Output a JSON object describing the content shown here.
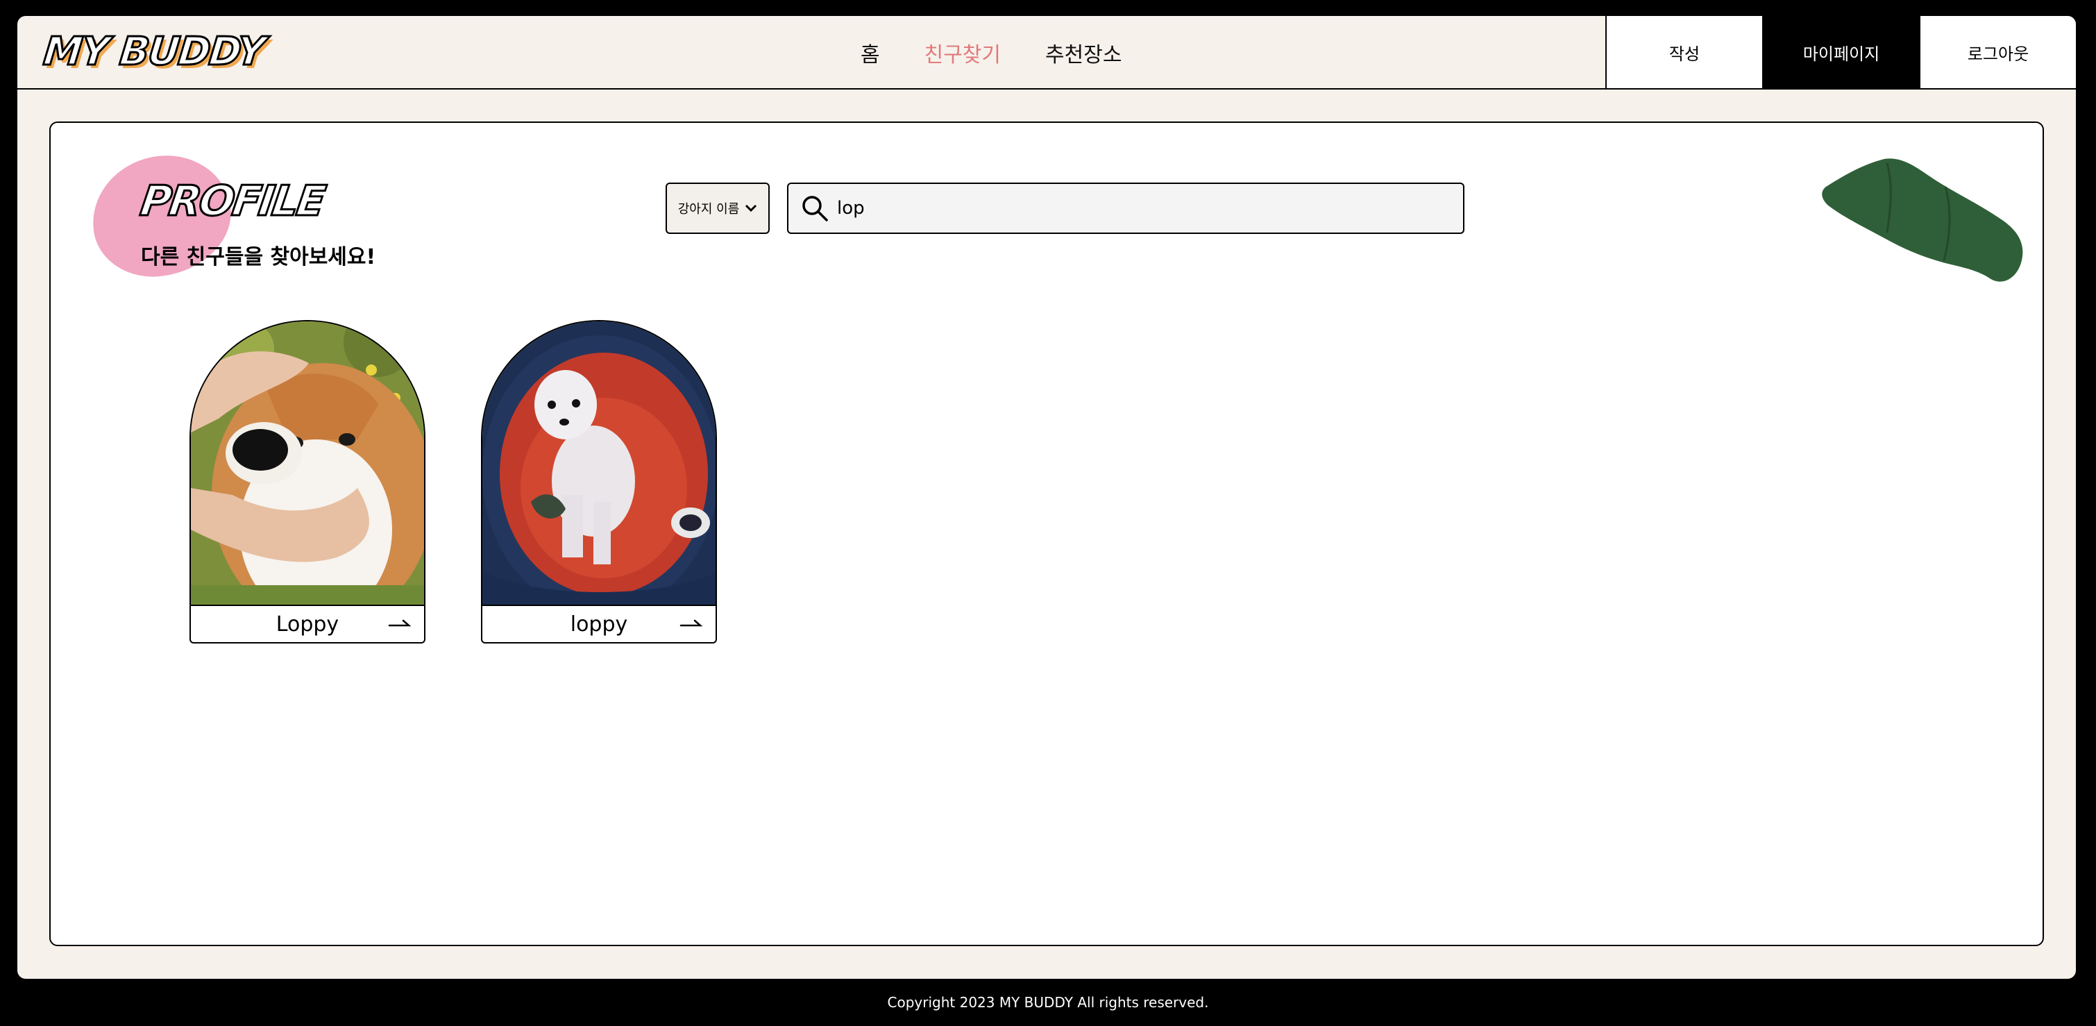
{
  "header": {
    "logo": "MY BUDDY",
    "nav": [
      "홈",
      "친구찾기",
      "추천장소"
    ],
    "active_nav": "친구찾기",
    "buttons": {
      "write": "작성",
      "mypage": "마이페이지",
      "logout": "로그아웃"
    }
  },
  "profile": {
    "title": "PROFILE",
    "subtitle": "다른 친구들을 찾아보세요!"
  },
  "search": {
    "filter_label": "강아지 이름",
    "value": "lop"
  },
  "dogs": [
    {
      "name": "Loppy"
    },
    {
      "name": "loppy"
    }
  ],
  "colors": {
    "accent": "#e07a7a",
    "background": "#f7f1ec",
    "blob": "#f1a6c2",
    "decor_green": "#2f5f38"
  },
  "footer": {
    "text": "Copyright 2023 MY BUDDY All rights reserved."
  }
}
